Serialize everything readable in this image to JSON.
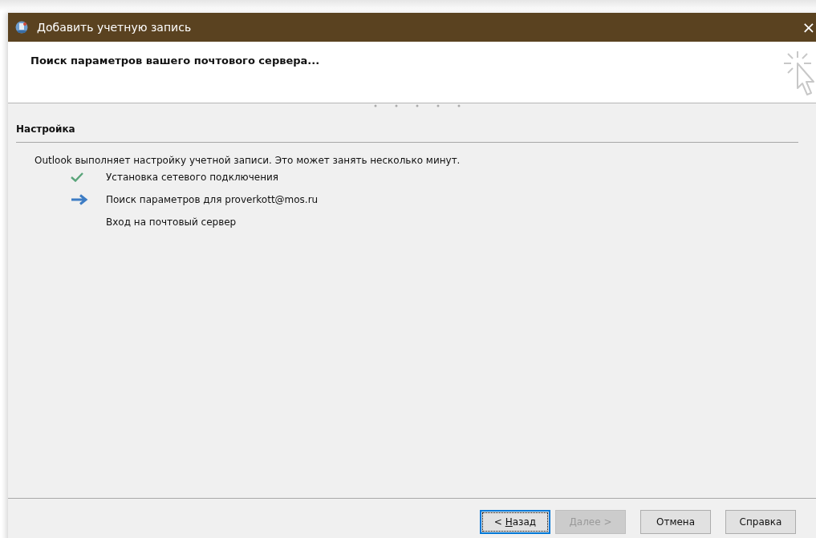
{
  "window": {
    "title": "Добавить учетную запись",
    "close": "×"
  },
  "header": {
    "title": "Поиск параметров вашего почтового сервера..."
  },
  "section": {
    "title": "Настройка"
  },
  "message": "Outlook выполняет настройку учетной записи. Это может занять несколько минут.",
  "steps": [
    {
      "label": "Установка сетевого подключения",
      "kind": "done"
    },
    {
      "label": "Поиск параметров для proverkott@mos.ru",
      "kind": "current"
    },
    {
      "label": "Вход на почтовый сервер",
      "kind": "pending"
    }
  ],
  "buttons": [
    {
      "prefix": "< ",
      "key": "Н",
      "suffix": "азад",
      "disabled": false,
      "focused": true
    },
    {
      "key": "Д",
      "suffix": "алее >",
      "disabled": true,
      "focused": false
    },
    {
      "suffix": "Отмена",
      "disabled": false,
      "focused": false
    },
    {
      "suffix": "Справка",
      "disabled": false,
      "focused": false
    }
  ]
}
